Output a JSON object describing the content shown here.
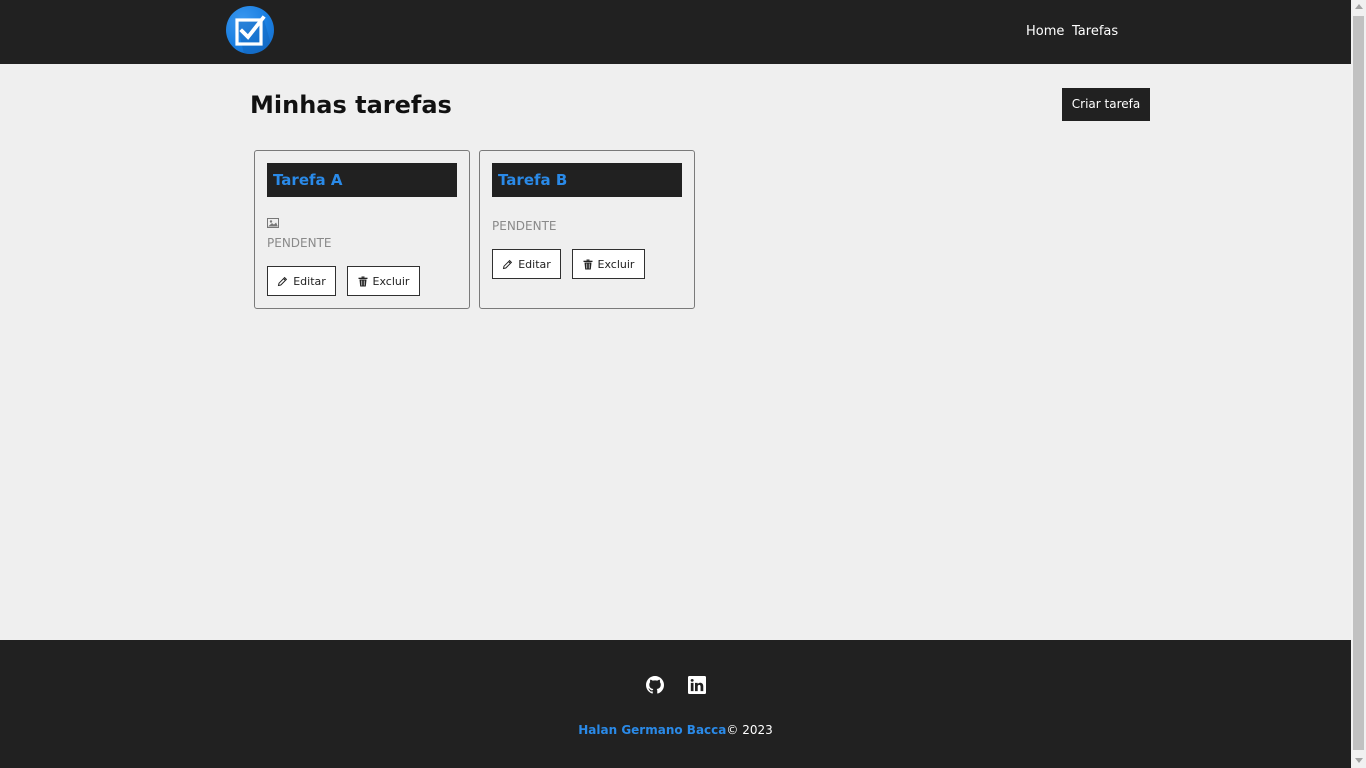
{
  "header": {
    "logo_alt": "check-box logo",
    "nav": [
      {
        "label": "Home"
      },
      {
        "label": "Tarefas"
      }
    ]
  },
  "main": {
    "title": "Minhas tarefas",
    "create_button": "Criar tarefa",
    "cards": [
      {
        "title": "Tarefa A",
        "has_image_placeholder": true,
        "status": "PENDENTE",
        "edit_label": "Editar",
        "delete_label": "Excluir"
      },
      {
        "title": "Tarefa B",
        "has_image_placeholder": false,
        "status": "PENDENTE",
        "edit_label": "Editar",
        "delete_label": "Excluir"
      }
    ]
  },
  "footer": {
    "social": [
      {
        "icon": "github-icon"
      },
      {
        "icon": "linkedin-icon"
      }
    ],
    "author": "Halan Germano Bacca",
    "copyright": "© 2023"
  },
  "colors": {
    "header_bg": "#212121",
    "page_bg": "#efefef",
    "accent": "#2a8ae8",
    "status_text": "#8a8a8a"
  }
}
